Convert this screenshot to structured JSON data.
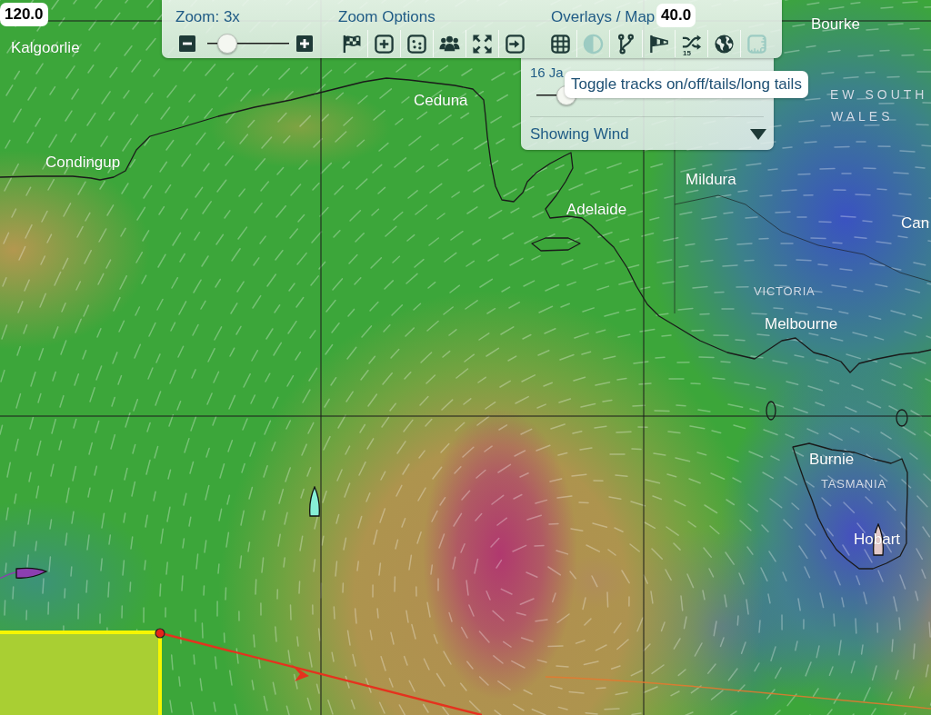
{
  "toolbar": {
    "zoom": {
      "label": "Zoom: 3x",
      "level": 0.24
    },
    "zoom_options": {
      "title": "Zoom Options"
    },
    "overlays": {
      "title": "Overlays / Map",
      "buttons": [
        {
          "active": true
        },
        {
          "active": false
        },
        {
          "active": true
        },
        {
          "active": true
        },
        {
          "active": true,
          "badge": "15"
        },
        {
          "active": true
        },
        {
          "active": false
        }
      ]
    }
  },
  "time_panel": {
    "date": "16 Ja",
    "level": 0.13,
    "layer": "Showing Wind"
  },
  "tooltip": {
    "text": "Toggle tracks on/off/tails/long tails"
  },
  "map": {
    "grid_labels": [
      "120.0",
      "40.0"
    ],
    "places": [
      {
        "name": "Bourke",
        "kind": "town"
      },
      {
        "name": "Kalgoorlie",
        "kind": "town"
      },
      {
        "name": "EW SOUTH",
        "kind": "region"
      },
      {
        "name": "Ceduna",
        "kind": "town"
      },
      {
        "name": "WALES",
        "kind": "region"
      },
      {
        "name": "Condingup",
        "kind": "town"
      },
      {
        "name": "Mildura",
        "kind": "town"
      },
      {
        "name": "Adelaide",
        "kind": "town"
      },
      {
        "name": "Can",
        "kind": "town"
      },
      {
        "name": "VICTORIA",
        "kind": "region"
      },
      {
        "name": "Melbourne",
        "kind": "town"
      },
      {
        "name": "Burnie",
        "kind": "town"
      },
      {
        "name": "TASMANIA",
        "kind": "region"
      },
      {
        "name": "Hobart",
        "kind": "town"
      }
    ],
    "boats": [
      {
        "color": "#86efd6"
      },
      {
        "color": "#8c3fb0"
      },
      {
        "color": "#e4caca"
      }
    ]
  }
}
